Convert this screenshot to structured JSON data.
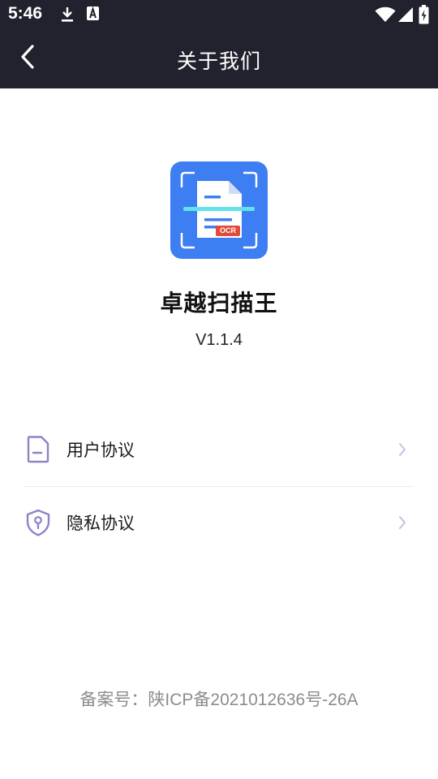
{
  "status_bar": {
    "time": "5:46",
    "icons": [
      "download-icon",
      "text-a-icon",
      "wifi-icon",
      "cellular-signal-icon",
      "battery-charging-icon"
    ]
  },
  "header": {
    "title": "关于我们",
    "back_icon": "chevron-left-icon"
  },
  "app": {
    "name": "卓越扫描王",
    "version": "V1.1.4",
    "logo_badge": "OCR",
    "logo_color": "#3d7ef2"
  },
  "menu": {
    "items": [
      {
        "label": "用户协议",
        "icon": "document-icon"
      },
      {
        "label": "隐私协议",
        "icon": "shield-icon"
      }
    ],
    "icon_color": "#8a84c9",
    "chevron_color": "#c4c1e0"
  },
  "footer": {
    "icp": "备案号：陕ICP备2021012636号-26A"
  },
  "colors": {
    "header_bg": "#22222e"
  }
}
